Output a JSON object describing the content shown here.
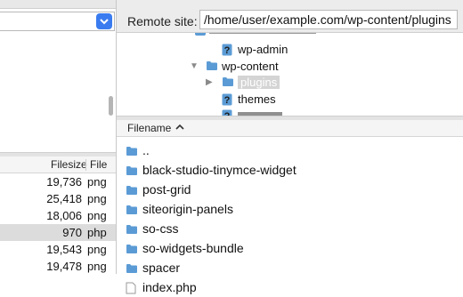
{
  "left": {
    "columns": {
      "filesize": "Filesize",
      "filetype": "File"
    },
    "rows": [
      {
        "size": "19,736",
        "ext": "png",
        "selected": false
      },
      {
        "size": "25,418",
        "ext": "png",
        "selected": false
      },
      {
        "size": "18,006",
        "ext": "png",
        "selected": false
      },
      {
        "size": "970",
        "ext": "php",
        "selected": true
      },
      {
        "size": "19,543",
        "ext": "png",
        "selected": false
      },
      {
        "size": "19,478",
        "ext": "png",
        "selected": false
      }
    ]
  },
  "remote": {
    "label": "Remote site:",
    "path": "/home/user/example.com/wp-content/plugins",
    "tree": [
      {
        "label": "wp-admin",
        "icon": "question-folder-icon"
      },
      {
        "label": "wp-content",
        "icon": "folder-icon",
        "expanded": true
      },
      {
        "label": "plugins",
        "icon": "folder-icon",
        "selected": true,
        "collapsed": true
      },
      {
        "label": "themes",
        "icon": "question-folder-icon"
      }
    ],
    "column_filename": "Filename",
    "files": [
      {
        "name": "..",
        "type": "folder"
      },
      {
        "name": "black-studio-tinymce-widget",
        "type": "folder"
      },
      {
        "name": "post-grid",
        "type": "folder"
      },
      {
        "name": "siteorigin-panels",
        "type": "folder"
      },
      {
        "name": "so-css",
        "type": "folder"
      },
      {
        "name": "so-widgets-bundle",
        "type": "folder"
      },
      {
        "name": "spacer",
        "type": "folder"
      },
      {
        "name": "index.php",
        "type": "file"
      }
    ]
  },
  "colors": {
    "accent": "#3a7cf0",
    "folder": "#5b9bd5",
    "selection": "#dcdcdc"
  }
}
